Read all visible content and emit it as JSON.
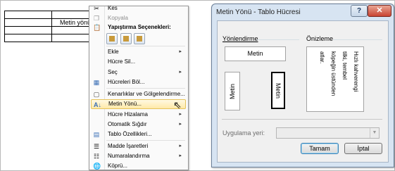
{
  "table": {
    "cell_text": "Metin yönü"
  },
  "menu": {
    "cut_label": "Kes",
    "copy_label": "Kopyala",
    "paste_options_label": "Yapıştırma Seçenekleri:",
    "items": [
      {
        "label": "Ekle",
        "arrow": "▸"
      },
      {
        "label": "Hücre Sil..."
      },
      {
        "label": "Seç",
        "arrow": "▸"
      },
      {
        "label": "Hücreleri Böl..."
      },
      {
        "label": "Kenarlıklar ve Gölgelendirme..."
      },
      {
        "label": "Metin Yönü..."
      },
      {
        "label": "Hücre Hizalama",
        "arrow": "▸"
      },
      {
        "label": "Otomatik Sığdır",
        "arrow": "▸"
      },
      {
        "label": "Tablo Özellikleri..."
      },
      {
        "label": "Madde İşaretleri",
        "arrow": "▸"
      },
      {
        "label": "Numaralandırma",
        "arrow": "▸"
      },
      {
        "label": "Köprü..."
      }
    ]
  },
  "dialog": {
    "title": "Metin Yönü - Tablo Hücresi",
    "help_label": "?",
    "close_label": "✕",
    "orientation_label": "Yönlendirme",
    "preview_label": "Önizleme",
    "opt_horizontal": "Metin",
    "opt_up": "Metin",
    "opt_down": "Metin",
    "preview_lines": [
      "Hızlı kahverengi",
      "tilki, tembel",
      "köpeğin üstünden",
      "atlar."
    ],
    "apply_to_label": "Uygulama yeri:",
    "apply_to_value": "",
    "ok_label": "Tamam",
    "cancel_label": "İptal"
  }
}
